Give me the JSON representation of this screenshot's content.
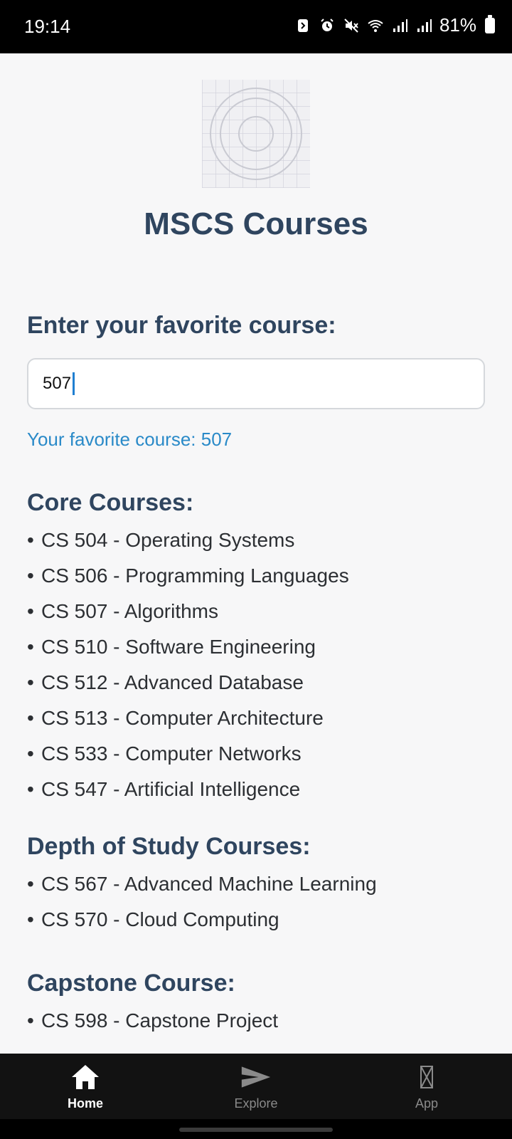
{
  "status_bar": {
    "time": "19:14",
    "battery": "81%"
  },
  "header": {
    "title": "MSCS Courses"
  },
  "favorite": {
    "label": "Enter your favorite course:",
    "input_value": "507",
    "result_text": "Your favorite course: 507"
  },
  "sections": {
    "core": {
      "heading": "Core Courses:",
      "items": [
        "CS 504 - Operating Systems",
        "CS 506 - Programming Languages",
        "CS 507 - Algorithms",
        "CS 510 - Software Engineering",
        "CS 512 - Advanced Database",
        "CS 513 - Computer Architecture",
        "CS 533 - Computer Networks",
        "CS 547 - Artificial Intelligence"
      ]
    },
    "depth": {
      "heading": "Depth of Study Courses:",
      "items": [
        "CS 567 - Advanced Machine Learning",
        "CS 570 - Cloud Computing"
      ]
    },
    "capstone": {
      "heading": "Capstone Course:",
      "items": [
        "CS 598 - Capstone Project"
      ]
    }
  },
  "bottom_nav": {
    "home": "Home",
    "explore": "Explore",
    "app": "App"
  },
  "colors": {
    "heading": "#2f455f",
    "accent": "#2a8ac8",
    "nav_bg": "#121212"
  }
}
